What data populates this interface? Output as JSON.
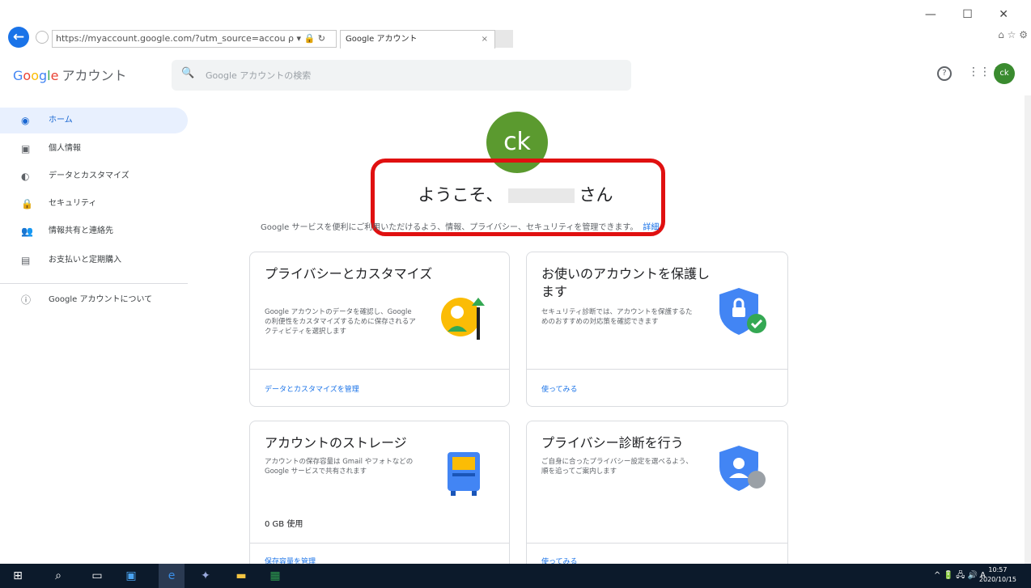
{
  "browser": {
    "url": "https://myaccount.google.com/?utm_source=accou",
    "addr_controls": "ρ ▾ 🔒 ↻",
    "tab_title": "Google アカウント",
    "tab_close": "×",
    "window_controls": "— ☐ ✕",
    "favorites": "⌂ ☆ ⚙"
  },
  "header": {
    "logo_letters": [
      "G",
      "o",
      "o",
      "g",
      "l",
      "e"
    ],
    "logo_suffix": "アカウント",
    "search_placeholder": "Google アカウントの検索",
    "help_icon": "?",
    "apps_icon": "⋮⋮⋮",
    "avatar_initials": "ck"
  },
  "sidebar": {
    "items": [
      {
        "label": "ホーム",
        "icon": "◉",
        "active": true
      },
      {
        "label": "個人情報",
        "icon": "▣"
      },
      {
        "label": "データとカスタマイズ",
        "icon": "◐"
      },
      {
        "label": "セキュリティ",
        "icon": "🔒"
      },
      {
        "label": "情報共有と連絡先",
        "icon": "👥"
      },
      {
        "label": "お支払いと定期購入",
        "icon": "▤"
      }
    ],
    "about": {
      "label": "Google アカウントについて",
      "icon": "ⓘ"
    }
  },
  "main": {
    "avatar_initials": "ck",
    "welcome_prefix": "ようこそ、",
    "welcome_suffix": "さん",
    "subtitle": "Google サービスを便利にご利用いただけるよう、情報、プライバシー、セキュリティを管理できます。",
    "subtitle_link": "詳細",
    "cards": [
      {
        "title": "プライバシーとカスタマイズ",
        "desc": "Google アカウントのデータを確認し、Google の利便性をカスタマイズするために保存されるアクティビティを選択します",
        "action": "データとカスタマイズを管理"
      },
      {
        "title": "お使いのアカウントを保護します",
        "desc": "セキュリティ診断では、アカウントを保護するためのおすすめの対応策を確認できます",
        "action": "使ってみる"
      },
      {
        "title": "アカウントのストレージ",
        "desc": "アカウントの保存容量は Gmail やフォトなどの Google サービスで共有されます",
        "usage": "0 GB 使用",
        "action": "保存容量を管理"
      },
      {
        "title": "プライバシー診断を行う",
        "desc": "ご自身に合ったプライバシー設定を選べるよう、順を追ってご案内します",
        "action": "使ってみる"
      }
    ]
  },
  "taskbar": {
    "tray": "^ 🔋 🖧 🔊 A",
    "time": "10:57",
    "date": "2020/10/15"
  },
  "colors": {
    "accent": "#1a73e8",
    "highlight_box": "#e01010",
    "avatar_green": "#5b9a2f"
  }
}
